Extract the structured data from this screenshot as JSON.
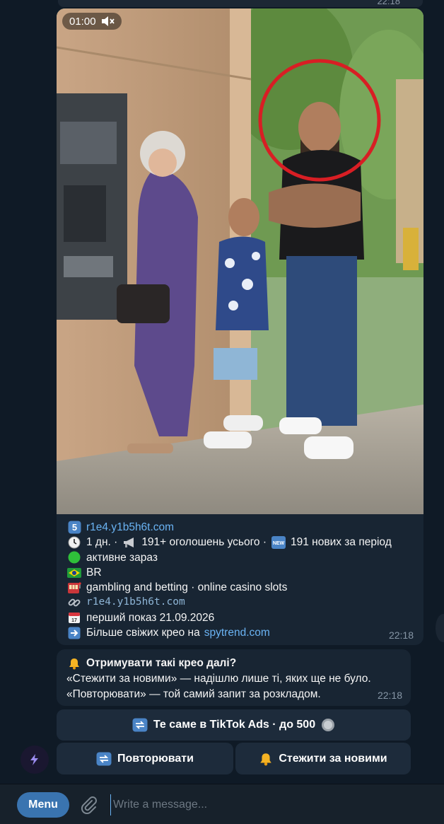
{
  "header": {
    "time_partial": "22:18"
  },
  "media": {
    "duration": "01:00"
  },
  "post": {
    "domain_emoji": "5",
    "domain": "r1e4.y1b5h6t.com",
    "stats_days": "1 дн. ·",
    "stats_ads": "191+ оголошень усього ·",
    "stats_new_badge": "NEW",
    "stats_new": "191 нових за період",
    "status": "активне зараз",
    "country": "BR",
    "category": "gambling and betting · online casino slots",
    "link_mono": "r1e4.y1b5h6t.com",
    "calendar_day": "17",
    "first_shown": "перший показ 21.09.2026",
    "more_prefix": "Більше свіжих крео на",
    "more_link": "spytrend.com",
    "time": "22:18"
  },
  "notice": {
    "title": "Отримувати такі крео далі?",
    "line1": "«Стежити за новими» — надішлю лише ті, яких ще не було.",
    "line2": "«Повторювати» — той самий запит за розкладом.",
    "time": "22:18"
  },
  "keyboard": {
    "tiktok_label": "Те саме в TikTok Ads · до 500",
    "repeat_label": "Повторювати",
    "follow_label": "Стежити за новими"
  },
  "composer": {
    "menu_label": "Menu",
    "placeholder": "Write a message..."
  },
  "colors": {
    "background": "#0e1621",
    "bubble": "#182533",
    "link": "#6ab3f3",
    "button": "#1d2b3b",
    "menu_button": "#3a74b0",
    "status_green": "#2fbf3a",
    "highlight_circle": "#d81e24"
  },
  "icons": {
    "mute": "speaker-muted-icon",
    "clock": "clock-icon",
    "megaphone": "megaphone-icon",
    "status": "green-circle-icon",
    "flag": "brazil-flag-icon",
    "casino": "slot-machine-icon",
    "link": "chain-link-icon",
    "calendar": "calendar-icon",
    "arrow": "arrow-right-icon",
    "bell": "bell-icon",
    "repeat": "repeat-icon",
    "coin": "coin-icon",
    "attach": "paperclip-icon",
    "bot": "lightning-icon"
  }
}
